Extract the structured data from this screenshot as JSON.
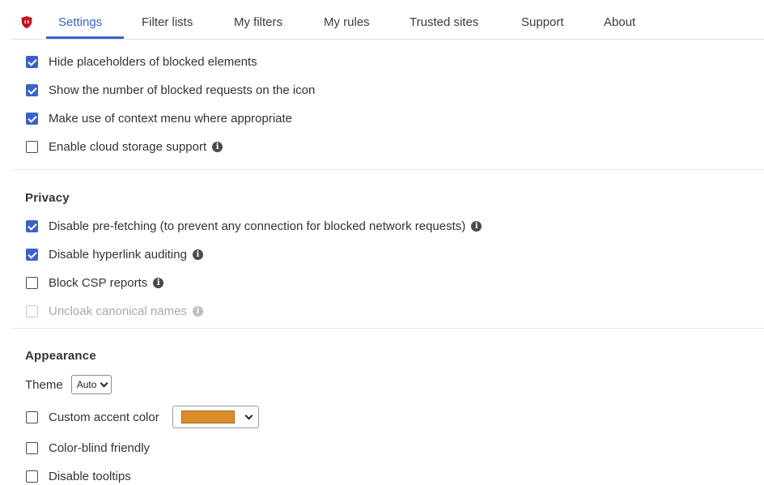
{
  "tabs": [
    {
      "label": "Settings",
      "active": true
    },
    {
      "label": "Filter lists",
      "active": false
    },
    {
      "label": "My filters",
      "active": false
    },
    {
      "label": "My rules",
      "active": false
    },
    {
      "label": "Trusted sites",
      "active": false
    },
    {
      "label": "Support",
      "active": false
    },
    {
      "label": "About",
      "active": false
    }
  ],
  "general": {
    "items": [
      {
        "label": "Hide placeholders of blocked elements",
        "checked": true,
        "info": false
      },
      {
        "label": "Show the number of blocked requests on the icon",
        "checked": true,
        "info": false
      },
      {
        "label": "Make use of context menu where appropriate",
        "checked": true,
        "info": false
      },
      {
        "label": "Enable cloud storage support",
        "checked": false,
        "info": true
      }
    ]
  },
  "privacy": {
    "heading": "Privacy",
    "items": [
      {
        "label": "Disable pre-fetching (to prevent any connection for blocked network requests)",
        "checked": true,
        "info": true
      },
      {
        "label": "Disable hyperlink auditing",
        "checked": true,
        "info": true
      },
      {
        "label": "Block CSP reports",
        "checked": false,
        "info": true
      },
      {
        "label": "Uncloak canonical names",
        "checked": false,
        "info": true,
        "disabled": true
      }
    ]
  },
  "appearance": {
    "heading": "Appearance",
    "theme_label": "Theme",
    "theme_value": "Auto",
    "accent_label": "Custom accent color",
    "accent_checked": false,
    "accent_color": "#d98e2a",
    "colorblind_label": "Color-blind friendly",
    "colorblind_checked": false,
    "tooltips_label": "Disable tooltips",
    "tooltips_checked": false
  },
  "info_glyph": "i",
  "colors": {
    "accent": "#3b62c9",
    "logo": "#c4101d"
  }
}
